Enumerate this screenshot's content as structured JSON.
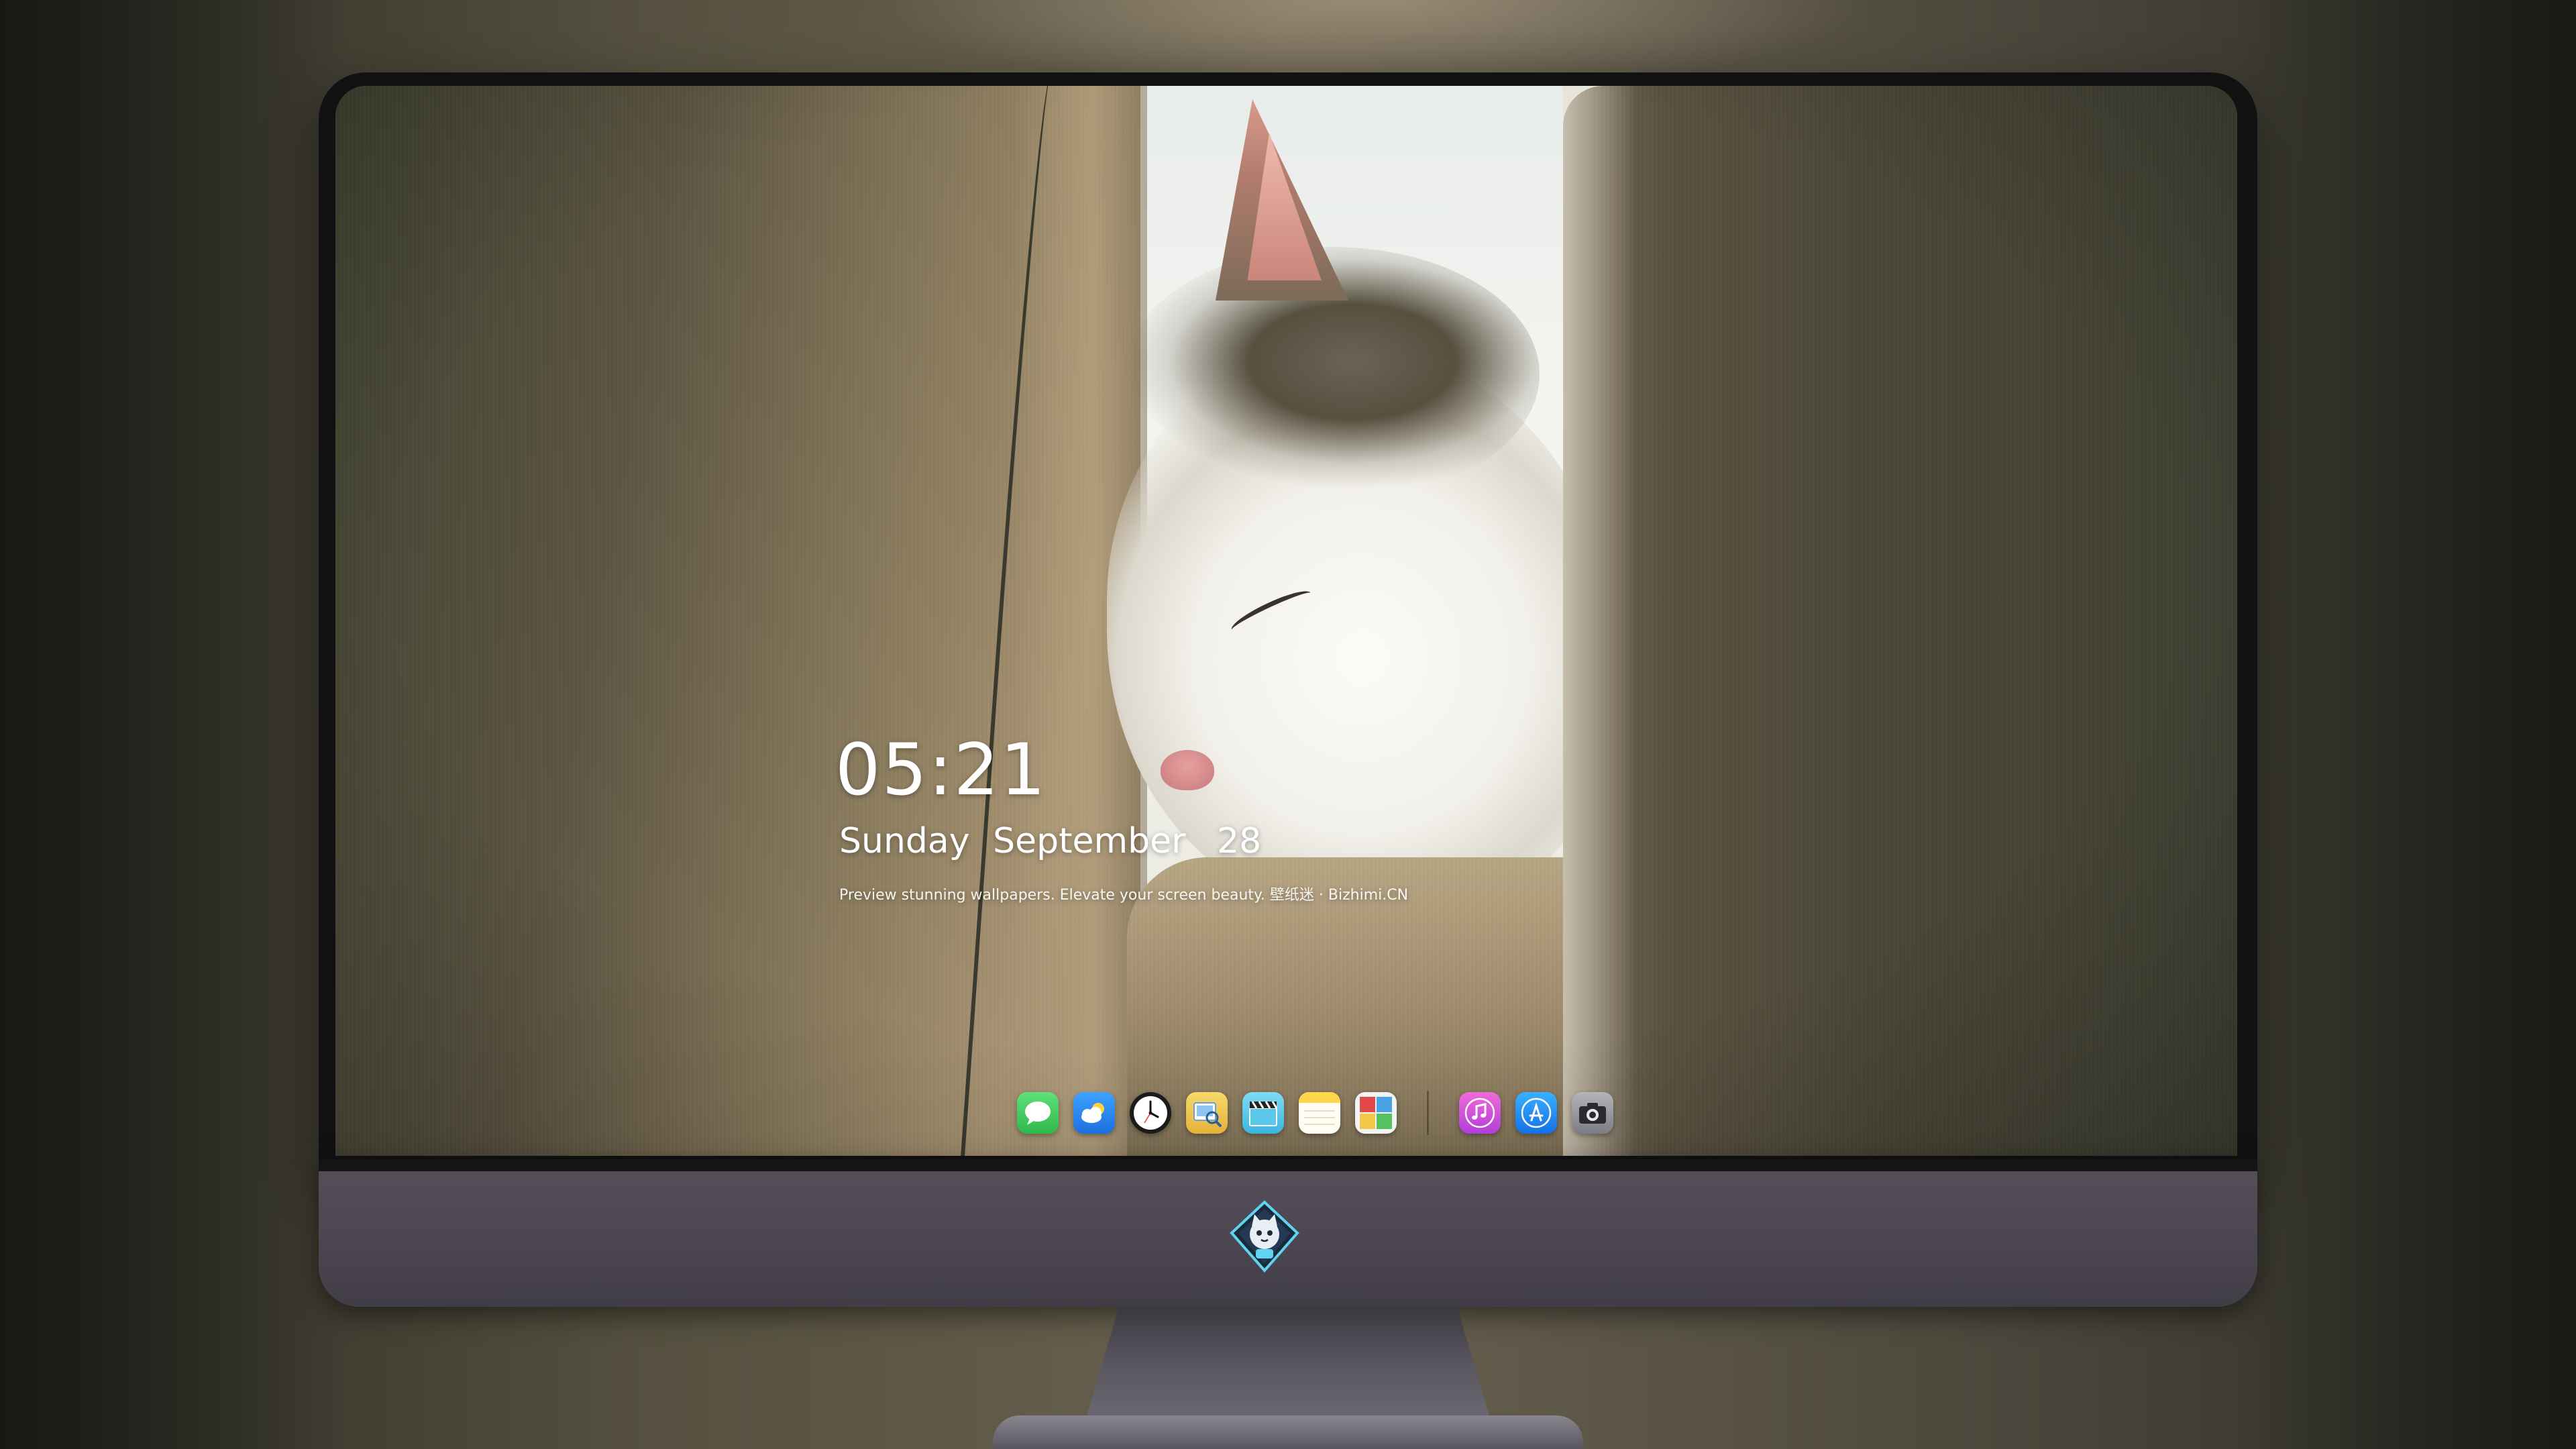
{
  "lock_screen": {
    "time": "05:21",
    "date": {
      "weekday": "Sunday",
      "month": "September",
      "day": "28"
    },
    "tagline": "Preview stunning wallpapers. Elevate your screen beauty. 壁纸迷 · Bizhimi.CN"
  },
  "wallpaper": {
    "subject": "sleeping-cat-between-cushions"
  },
  "dock": {
    "apps": [
      {
        "name": "messages",
        "icon": "speech-bubble-icon",
        "color": "#34c759"
      },
      {
        "name": "weather",
        "icon": "cloud-sun-icon",
        "color": "#2d8cf0"
      },
      {
        "name": "clock",
        "icon": "clock-icon",
        "color": "#ffffff"
      },
      {
        "name": "preview",
        "icon": "photo-magnifier-icon",
        "color": "#f2c84b"
      },
      {
        "name": "videos",
        "icon": "clapperboard-icon",
        "color": "#5ac8e8"
      },
      {
        "name": "notes",
        "icon": "notepad-icon",
        "color": "#ffd54a"
      },
      {
        "name": "photo-booth",
        "icon": "photo-collage-icon",
        "color": "#e24a4a"
      },
      {
        "name": "music",
        "icon": "music-note-icon",
        "color": "#d64fd8"
      },
      {
        "name": "app-store",
        "icon": "app-store-icon",
        "color": "#1e8ef5"
      },
      {
        "name": "camera",
        "icon": "camera-icon",
        "color": "#8e8e93"
      }
    ]
  },
  "monitor": {
    "logo": "cat-mascot-diamond-logo"
  }
}
